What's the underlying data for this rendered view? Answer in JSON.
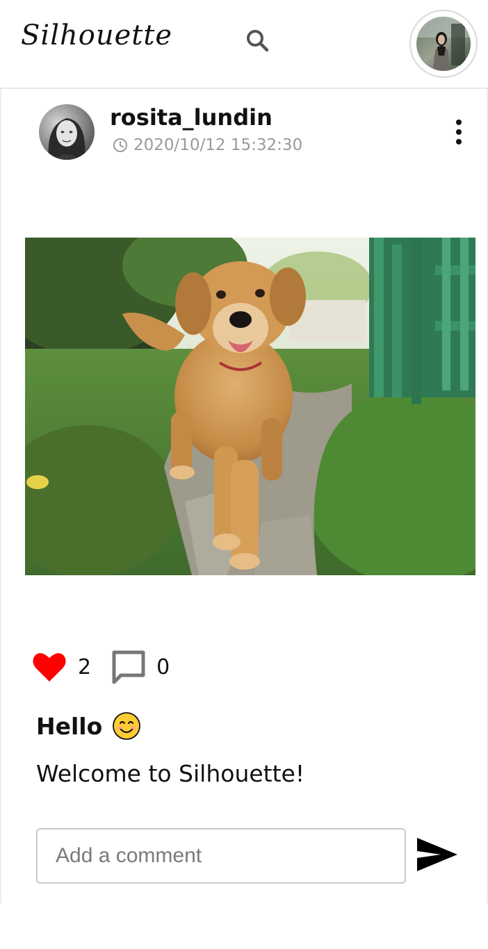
{
  "app": {
    "logo": "Silhouette"
  },
  "header": {
    "search_icon": "search-icon",
    "profile_icon": "user-avatar"
  },
  "post": {
    "author": {
      "username": "rosita_lundin",
      "timestamp": "2020/10/12 15:32:30"
    },
    "image_alt": "golden retriever on a stone path",
    "likes": {
      "count": "2",
      "liked": true,
      "color": "#ff0000"
    },
    "comments": {
      "count": "0"
    },
    "title": "Hello",
    "title_emoji": "😊",
    "body": "Welcome to Silhouette!",
    "comment_form": {
      "placeholder": "Add a comment"
    }
  }
}
